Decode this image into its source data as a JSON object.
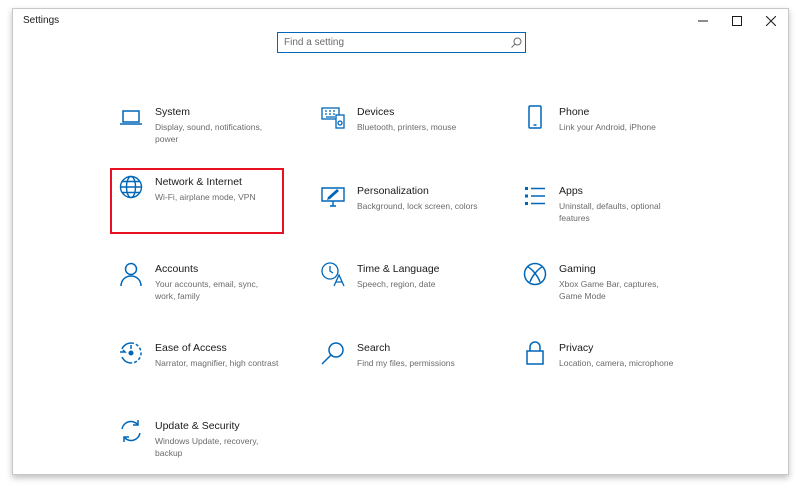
{
  "window": {
    "title": "Settings",
    "controls": {
      "minimize": "minimize",
      "maximize": "maximize",
      "close": "close"
    }
  },
  "search": {
    "placeholder": "Find a setting",
    "value": "",
    "icon": "search-icon"
  },
  "colors": {
    "accent": "#0067b8",
    "selection": "#e81123",
    "text": "#1a1a1a",
    "secondary": "#6b6b6b"
  },
  "categories": [
    {
      "name": "System",
      "desc": "Display, sound, notifications, power",
      "icon": "laptop-icon"
    },
    {
      "name": "Devices",
      "desc": "Bluetooth, printers, mouse",
      "icon": "devices-icon"
    },
    {
      "name": "Phone",
      "desc": "Link your Android, iPhone",
      "icon": "phone-icon"
    },
    {
      "name": "Network & Internet",
      "desc": "Wi-Fi, airplane mode, VPN",
      "icon": "globe-icon",
      "selected": true
    },
    {
      "name": "Personalization",
      "desc": "Background, lock screen, colors",
      "icon": "personalization-icon"
    },
    {
      "name": "Apps",
      "desc": "Uninstall, defaults, optional features",
      "icon": "apps-icon"
    },
    {
      "name": "Accounts",
      "desc": "Your accounts, email, sync, work, family",
      "icon": "person-icon"
    },
    {
      "name": "Time & Language",
      "desc": "Speech, region, date",
      "icon": "time-language-icon"
    },
    {
      "name": "Gaming",
      "desc": "Xbox Game Bar, captures, Game Mode",
      "icon": "xbox-icon"
    },
    {
      "name": "Ease of Access",
      "desc": "Narrator, magnifier, high contrast",
      "icon": "ease-of-access-icon"
    },
    {
      "name": "Search",
      "desc": "Find my files, permissions",
      "icon": "magnifier-icon"
    },
    {
      "name": "Privacy",
      "desc": "Location, camera, microphone",
      "icon": "lock-icon"
    },
    {
      "name": "Update & Security",
      "desc": "Windows Update, recovery, backup",
      "icon": "sync-icon"
    }
  ]
}
